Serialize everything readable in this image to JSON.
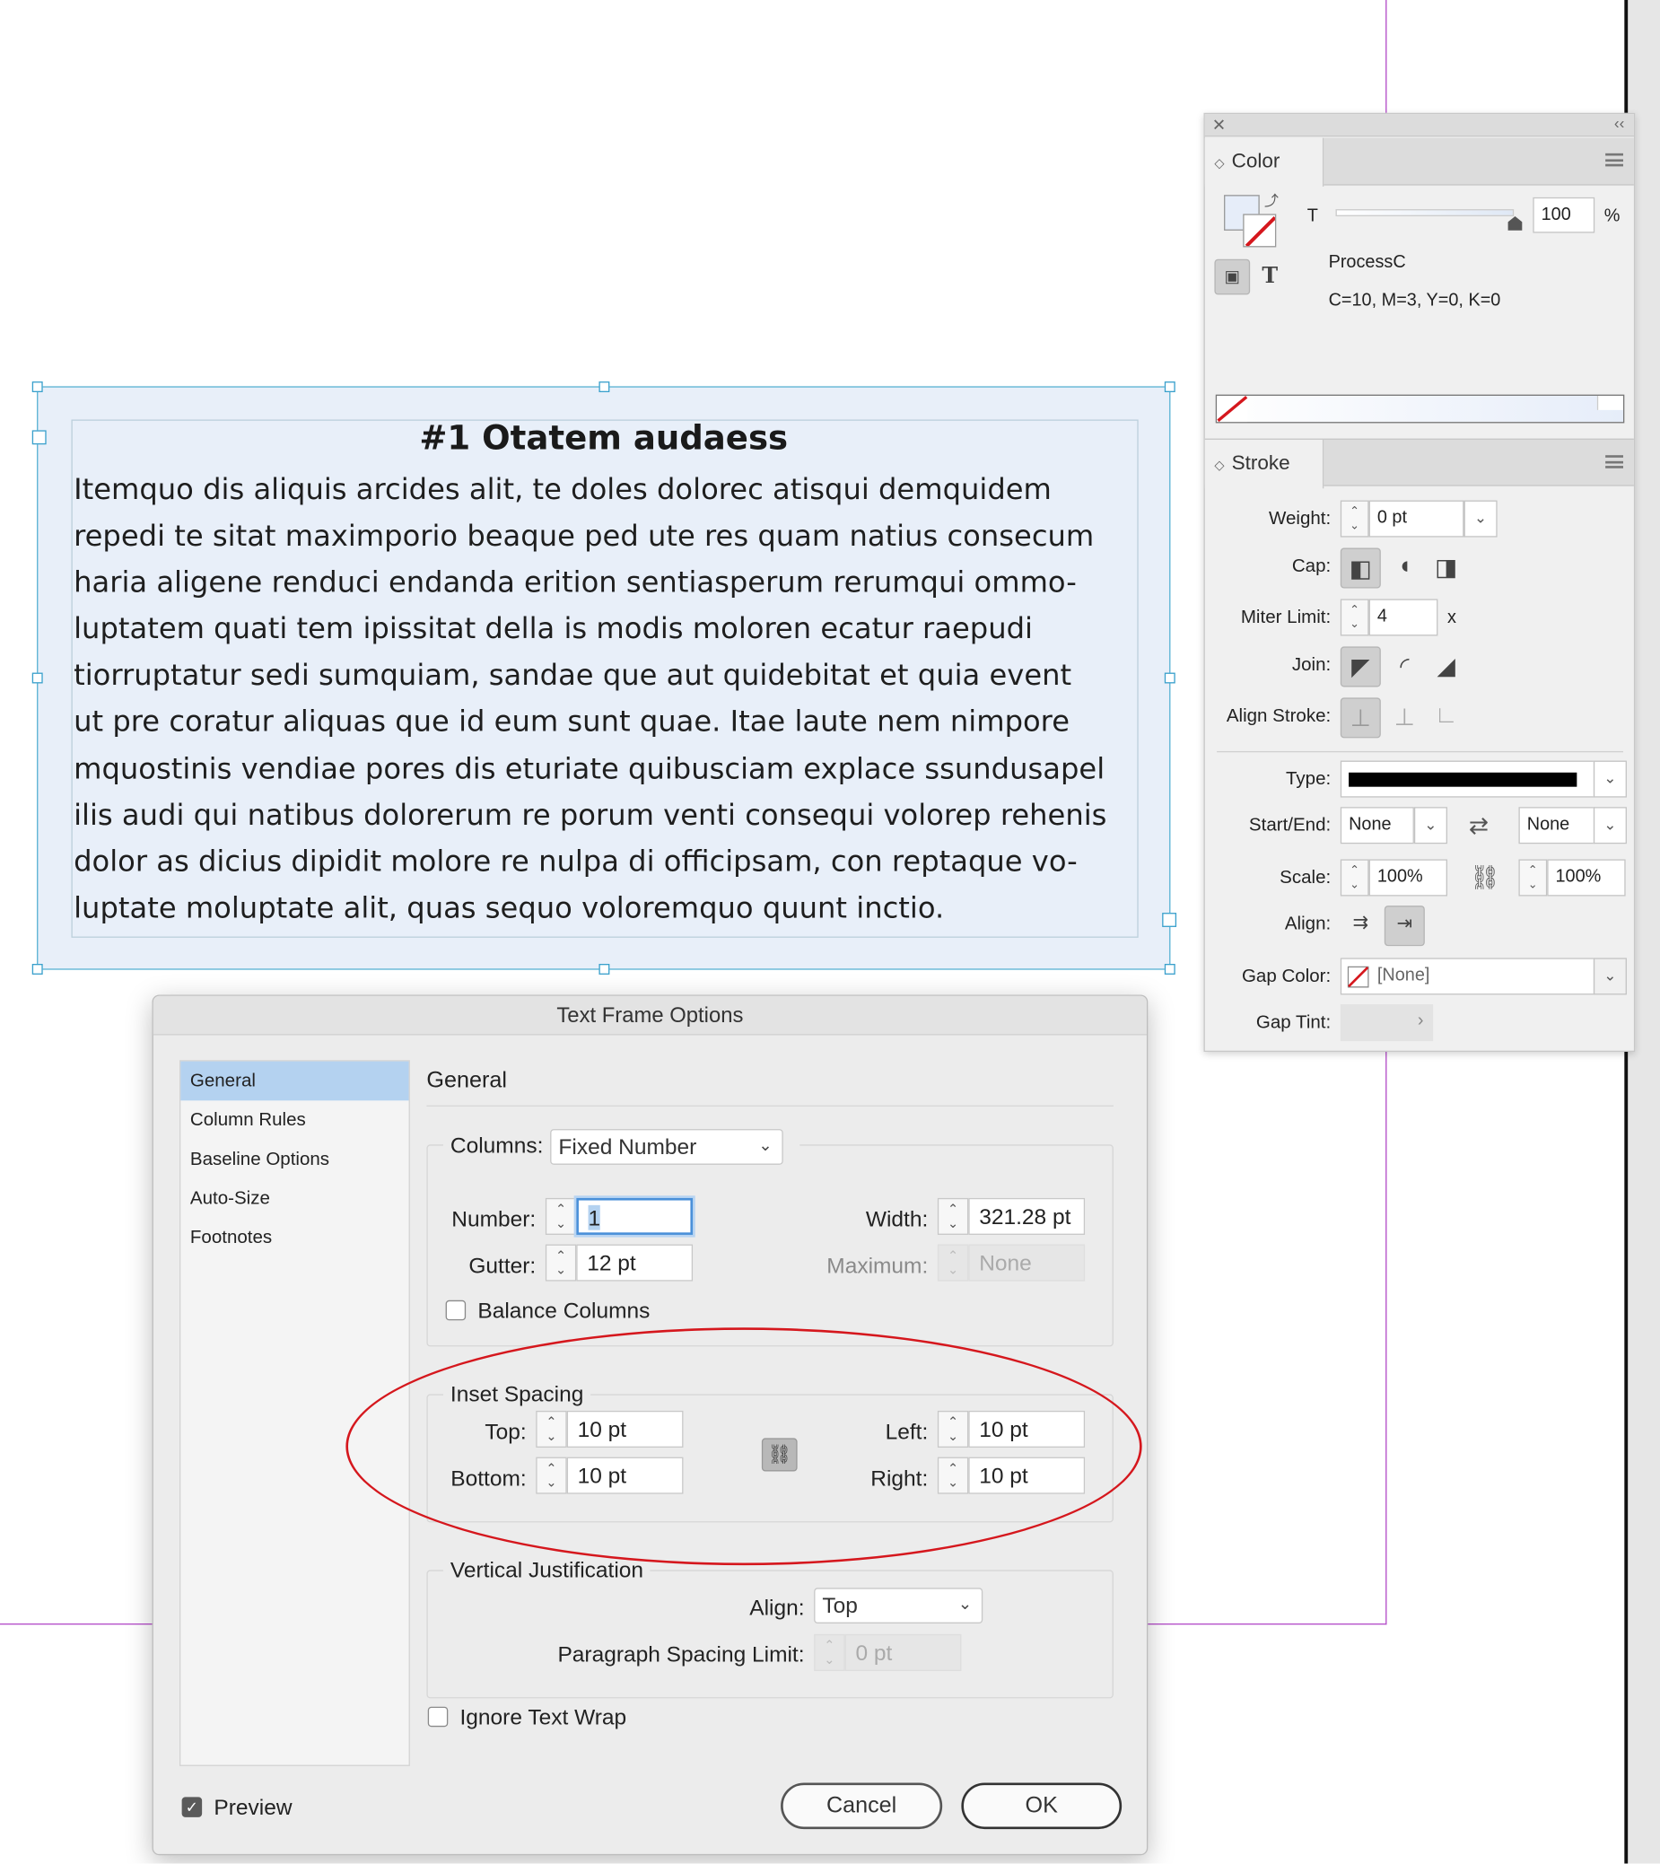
{
  "text_frame": {
    "title": "#1 Otatem audaess",
    "body_lines": [
      "Itemquo dis aliquis arcides alit, te doles dolorec atisqui demquidem",
      "repedi te sitat maximporio beaque ped ute res quam natius consecum",
      "haria aligene renduci endanda erition sentiasperum rerumqui ommo-",
      "luptatem quati tem ipissitat della is modis moloren ecatur raepudi",
      "tiorruptatur sedi sumquiam, sandae que aut quidebitat et quia event",
      "ut pre coratur aliquas que id eum sunt quae. Itae laute nem nimpore",
      "mquostinis vendiae pores dis eturiate quibusciam explace ssundusapel",
      "ilis audi qui natibus dolorerum re porum venti consequi volorep rehenis",
      "dolor as dicius dipidit molore re nulpa di officipsam, con reptaque vo-",
      "luptate moluptate alit, quas sequo voloremquo quunt inctio."
    ],
    "fill_color": "#e8eff9"
  },
  "color_panel": {
    "tab": "Color",
    "tint_label": "T",
    "tint_value": "100",
    "tint_unit": "%",
    "swatch_name": "ProcessC",
    "swatch_values": "C=10, M=3, Y=0, K=0",
    "swatch_color": "#e6edf9"
  },
  "stroke_panel": {
    "tab": "Stroke",
    "weight_label": "Weight:",
    "weight_value": "0 pt",
    "cap_label": "Cap:",
    "miter_label": "Miter Limit:",
    "miter_value": "4",
    "miter_unit": "x",
    "join_label": "Join:",
    "align_stroke_label": "Align Stroke:",
    "type_label": "Type:",
    "start_end_label": "Start/End:",
    "start_value": "None",
    "end_value": "None",
    "scale_label": "Scale:",
    "scale_start": "100%",
    "scale_end": "100%",
    "align_label": "Align:",
    "gap_color_label": "Gap Color:",
    "gap_color_value": "[None]",
    "gap_tint_label": "Gap Tint:"
  },
  "dialog": {
    "title": "Text Frame Options",
    "sidebar": [
      "General",
      "Column Rules",
      "Baseline Options",
      "Auto-Size",
      "Footnotes"
    ],
    "selected_section": "General",
    "section_heading": "General",
    "columns_label": "Columns:",
    "columns_value": "Fixed Number",
    "number_label": "Number:",
    "number_value": "1",
    "width_label": "Width:",
    "width_value": "321.28 pt",
    "gutter_label": "Gutter:",
    "gutter_value": "12 pt",
    "maximum_label": "Maximum:",
    "maximum_value": "None",
    "balance_columns_label": "Balance Columns",
    "balance_columns_checked": false,
    "inset_heading": "Inset Spacing",
    "top_label": "Top:",
    "top_value": "10 pt",
    "bottom_label": "Bottom:",
    "bottom_value": "10 pt",
    "left_label": "Left:",
    "left_value": "10 pt",
    "right_label": "Right:",
    "right_value": "10 pt",
    "vj_heading": "Vertical Justification",
    "align_label": "Align:",
    "align_value": "Top",
    "psl_label": "Paragraph Spacing Limit:",
    "psl_value": "0 pt",
    "ignore_wrap_label": "Ignore Text Wrap",
    "ignore_wrap_checked": false,
    "preview_label": "Preview",
    "preview_checked": true,
    "cancel_label": "Cancel",
    "ok_label": "OK"
  },
  "annotation_color": "#d5171d"
}
